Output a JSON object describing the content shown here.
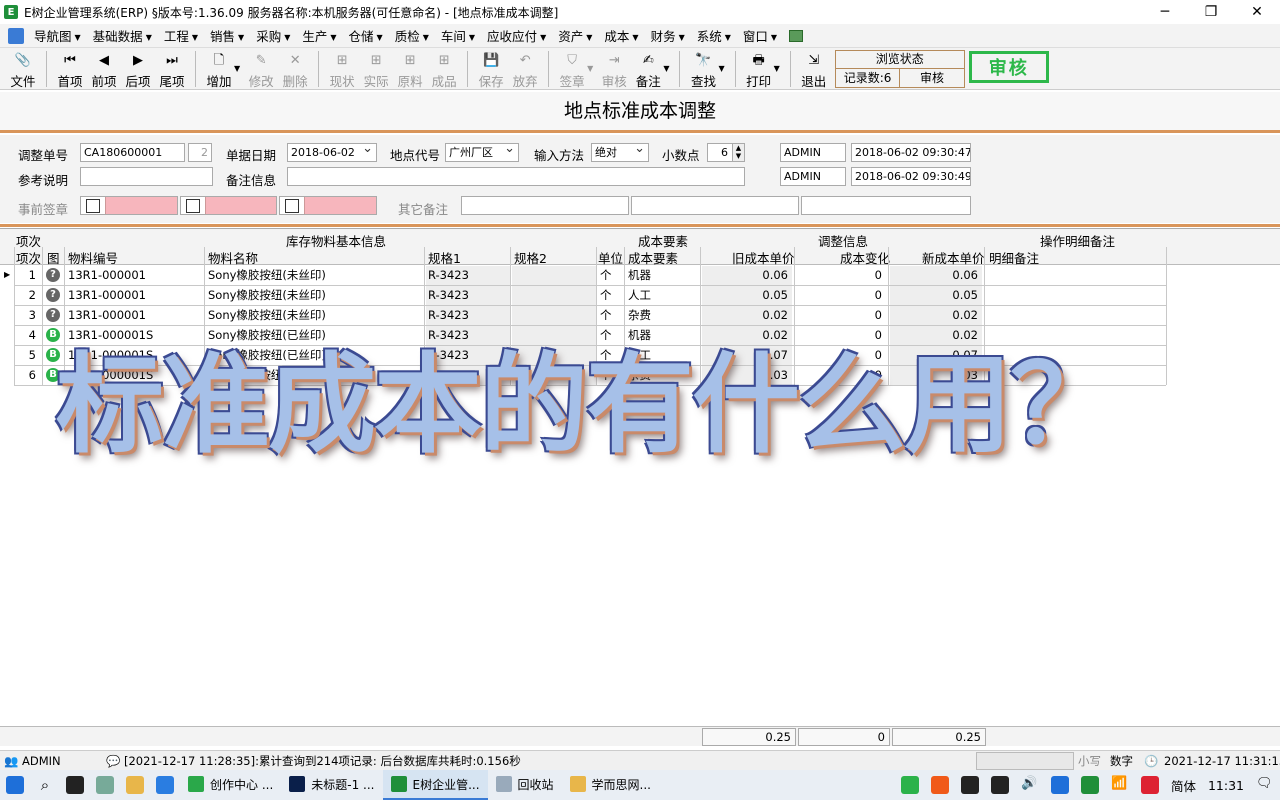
{
  "window": {
    "title": "E树企业管理系统(ERP) §版本号:1.36.09  服务器名称:本机服务器(可任意命名) - [地点标准成本调整]",
    "minimize": "─",
    "maximize": "❐",
    "close": "✕"
  },
  "menu": {
    "items": [
      "导航图",
      "基础数据",
      "工程",
      "销售",
      "采购",
      "生产",
      "仓储",
      "质检",
      "车间",
      "应收应付",
      "资产",
      "成本",
      "财务",
      "系统",
      "窗口"
    ]
  },
  "toolbar": {
    "file": "文件",
    "first": "首项",
    "prev": "前项",
    "next": "后项",
    "last": "尾项",
    "add": "增加",
    "modify": "修改",
    "delete": "删除",
    "status": "现状",
    "actual": "实际",
    "material": "原料",
    "product": "成品",
    "save": "保存",
    "discard": "放弃",
    "sign": "签章",
    "review": "审核",
    "note": "备注",
    "find": "查找",
    "print": "打印",
    "exit": "退出",
    "browse_state_title": "浏览状态",
    "record_count": "记录数:6",
    "state_value": "审核",
    "audit_stamp": "审核"
  },
  "form": {
    "title": "地点标准成本调整",
    "labels": {
      "adjust_no": "调整单号",
      "doc_date": "单据日期",
      "location_code": "地点代号",
      "input_method": "输入方法",
      "decimals": "小数点",
      "ref_desc": "参考说明",
      "remark": "备注信息",
      "pre_sign": "事前签章",
      "other_remark": "其它备注"
    },
    "values": {
      "adjust_no": "CA180600001",
      "adjust_seq": "2",
      "doc_date": "2018-06-02",
      "location_code": "广州厂区",
      "input_method": "绝对",
      "decimals": "6",
      "creator": "ADMIN",
      "created_at": "2018-06-02 09:30:47",
      "modifier": "ADMIN",
      "modified_at": "2018-06-02 09:30:49",
      "ref_desc": "",
      "remark": ""
    }
  },
  "grid": {
    "group_headers": {
      "seq": "项次",
      "basic_info": "库存物料基本信息",
      "cost_element": "成本要素",
      "adjust_info": "调整信息",
      "op_remark": "操作明细备注"
    },
    "columns": {
      "seq": "项次",
      "icon": "图",
      "item_no": "物料编号",
      "item_name": "物料名称",
      "spec1": "规格1",
      "spec2": "规格2",
      "unit": "单位",
      "cost_element": "成本要素",
      "old_price": "旧成本单价",
      "change": "成本变化",
      "new_price": "新成本单价",
      "detail_remark": "明细备注"
    },
    "rows": [
      {
        "seq": "1",
        "icon": "?",
        "item_no": "13R1-000001",
        "item_name": "Sony橡胶按纽(未丝印)",
        "spec1": "R-3423",
        "spec2": "",
        "unit": "个",
        "cost_element": "机器",
        "old_price": "0.06",
        "change": "0",
        "new_price": "0.06"
      },
      {
        "seq": "2",
        "icon": "?",
        "item_no": "13R1-000001",
        "item_name": "Sony橡胶按纽(未丝印)",
        "spec1": "R-3423",
        "spec2": "",
        "unit": "个",
        "cost_element": "人工",
        "old_price": "0.05",
        "change": "0",
        "new_price": "0.05"
      },
      {
        "seq": "3",
        "icon": "?",
        "item_no": "13R1-000001",
        "item_name": "Sony橡胶按纽(未丝印)",
        "spec1": "R-3423",
        "spec2": "",
        "unit": "个",
        "cost_element": "杂费",
        "old_price": "0.02",
        "change": "0",
        "new_price": "0.02"
      },
      {
        "seq": "4",
        "icon": "B",
        "item_no": "13R1-000001S",
        "item_name": "Sony橡胶按纽(已丝印)",
        "spec1": "R-3423",
        "spec2": "",
        "unit": "个",
        "cost_element": "机器",
        "old_price": "0.02",
        "change": "0",
        "new_price": "0.02"
      },
      {
        "seq": "5",
        "icon": "B",
        "item_no": "13R1-000001S",
        "item_name": "Sony橡胶按纽(已丝印)",
        "spec1": "R-3423",
        "spec2": "",
        "unit": "个",
        "cost_element": "人工",
        "old_price": "0.07",
        "change": "0",
        "new_price": "0.07"
      },
      {
        "seq": "6",
        "icon": "B",
        "item_no": "13R1-000001S",
        "item_name": "Sony橡胶按纽(已丝印)",
        "spec1": "R-3423",
        "spec2": "",
        "unit": "个",
        "cost_element": "杂费",
        "old_price": "0.03",
        "change": "0",
        "new_price": "0.03"
      }
    ],
    "totals": {
      "old_price": "0.25",
      "change": "0",
      "new_price": "0.25"
    }
  },
  "statusbar": {
    "user": "ADMIN",
    "message": "[2021-12-17 11:28:35]:累计查询到214项记录: 后台数据库共耗时:0.156秒",
    "caps": "小写",
    "numlock": "数字",
    "datetime": "2021-12-17 11:31:13"
  },
  "taskbar": {
    "apps": [
      "创作中心 ...",
      "未标题-1 ...",
      "E树企业管...",
      "回收站",
      "学而思网..."
    ],
    "ime": "简体",
    "time": "11:31"
  },
  "overlay": {
    "caption": "标准成本的有什么用？"
  },
  "colors": {
    "accent_orange": "#d9955a",
    "audit_green": "#2db84a",
    "pink_field": "#f7b6bd"
  }
}
